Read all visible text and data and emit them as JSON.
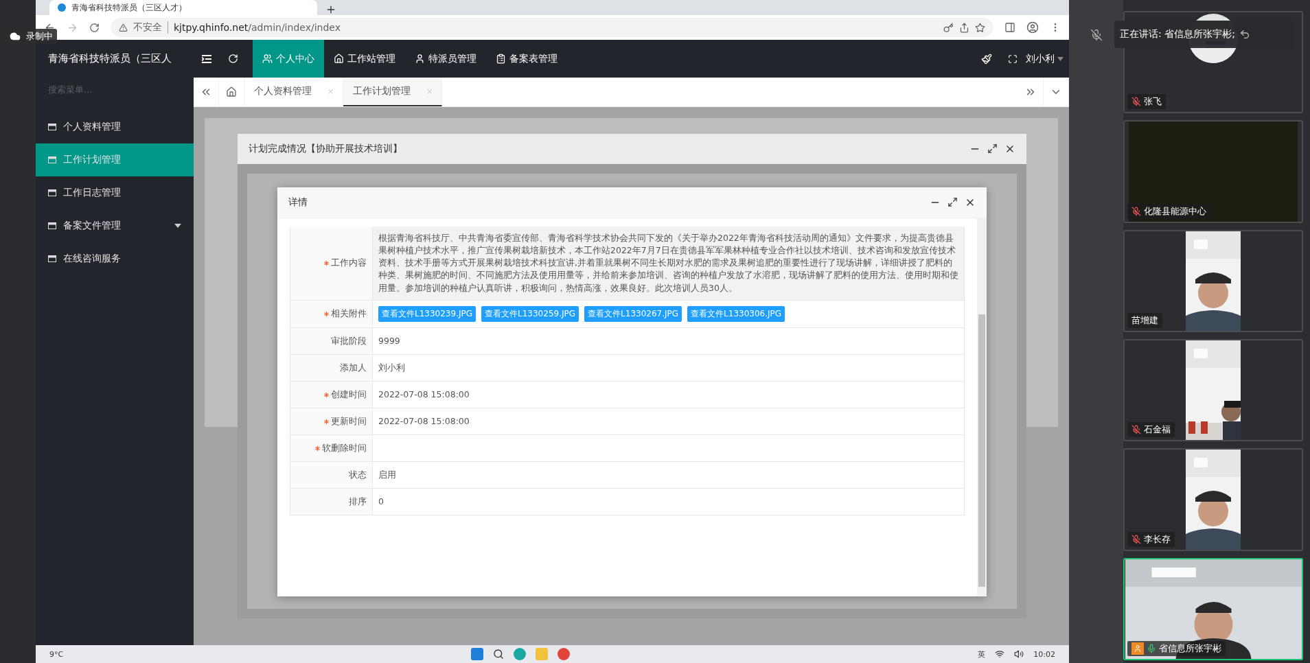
{
  "recording": {
    "label": "录制中"
  },
  "browser": {
    "tab_title": "青海省科技特派员（三区人才）",
    "security": "不安全",
    "url_host": "kjtpy.qhinfo.net",
    "url_path": "/admin/index/index"
  },
  "app": {
    "title": "青海省科技特派员（三区人",
    "user": "刘小利",
    "top_nav": [
      {
        "label": "个人中心",
        "selected": true
      },
      {
        "label": "工作站管理",
        "selected": false
      },
      {
        "label": "特派员管理",
        "selected": false
      },
      {
        "label": "备案表管理",
        "selected": false
      }
    ]
  },
  "sidebar": {
    "search_placeholder": "搜索菜单...",
    "items": [
      {
        "label": "个人资料管理",
        "selected": false,
        "expandable": false
      },
      {
        "label": "工作计划管理",
        "selected": true,
        "expandable": false
      },
      {
        "label": "工作日志管理",
        "selected": false,
        "expandable": false
      },
      {
        "label": "备案文件管理",
        "selected": false,
        "expandable": true
      },
      {
        "label": "在线咨询服务",
        "selected": false,
        "expandable": false
      }
    ]
  },
  "tabs": [
    {
      "label": "个人资料管理",
      "selected": false
    },
    {
      "label": "工作计划管理",
      "selected": true
    }
  ],
  "dialog": {
    "title": "计划完成情况【协助开展技术培训】"
  },
  "detail": {
    "title": "详情",
    "fields": [
      {
        "kind": "text",
        "label": "工作内容",
        "required": true,
        "value": "根据青海省科技厅、中共青海省委宣传部、青海省科学技术协会共同下发的《关于举办2022年青海省科技活动周的通知》文件要求，为提高贵德县果树种植户技术水平，推广宣传果树栽培新技术，本工作站2022年7月7日在贵德县军军果林种植专业合作社以技术培训、技术咨询和发放宣传技术资料、技术手册等方式开展果树栽培技术科技宣讲,并着重就果树不同生长期对水肥的需求及果树追肥的重要性进行了现场讲解，详细讲授了肥料的种类、果树施肥的时间、不同施肥方法及使用用量等，并给前来参加培训、咨询的种植户发放了水溶肥，现场讲解了肥料的使用方法、使用时期和使用量。参加培训的种植户认真听讲，积极询问，热情高涨，效果良好。此次培训人员30人。"
      },
      {
        "kind": "files",
        "label": "相关附件",
        "required": true,
        "files": [
          "查看文件L1330239.JPG",
          "查看文件L1330259.JPG",
          "查看文件L1330267.JPG",
          "查看文件L1330306.JPG"
        ]
      },
      {
        "kind": "text",
        "label": "审批阶段",
        "required": false,
        "value": "9999"
      },
      {
        "kind": "text",
        "label": "添加人",
        "required": false,
        "value": "刘小利"
      },
      {
        "kind": "text",
        "label": "创建时间",
        "required": true,
        "value": "2022-07-08 15:08:00"
      },
      {
        "kind": "text",
        "label": "更新时间",
        "required": true,
        "value": "2022-07-08 15:08:00"
      },
      {
        "kind": "text",
        "label": "软删除时间",
        "required": true
      },
      {
        "kind": "text",
        "label": "状态",
        "required": false,
        "value": "启用"
      },
      {
        "kind": "text",
        "label": "排序",
        "required": false,
        "value": "0"
      }
    ]
  },
  "meeting": {
    "speaking": "正在讲话: 省信息所张宇彬;",
    "participants": [
      {
        "name": "张飞",
        "muted": true,
        "kind": "avatar",
        "selected": false
      },
      {
        "name": "化隆县能源中心",
        "muted": true,
        "kind": "dark",
        "selected": false
      },
      {
        "name": "苗增建",
        "kind": "person",
        "selected": false
      },
      {
        "name": "石金福",
        "muted": true,
        "kind": "side",
        "selected": false
      },
      {
        "name": "李长存",
        "muted": true,
        "kind": "person",
        "selected": false
      },
      {
        "name": "省信息所张宇彬",
        "muted": false,
        "kind": "wide",
        "selected": true
      }
    ]
  },
  "taskbar": {
    "weather": "9°C",
    "ime": "英",
    "time": "10:02"
  }
}
